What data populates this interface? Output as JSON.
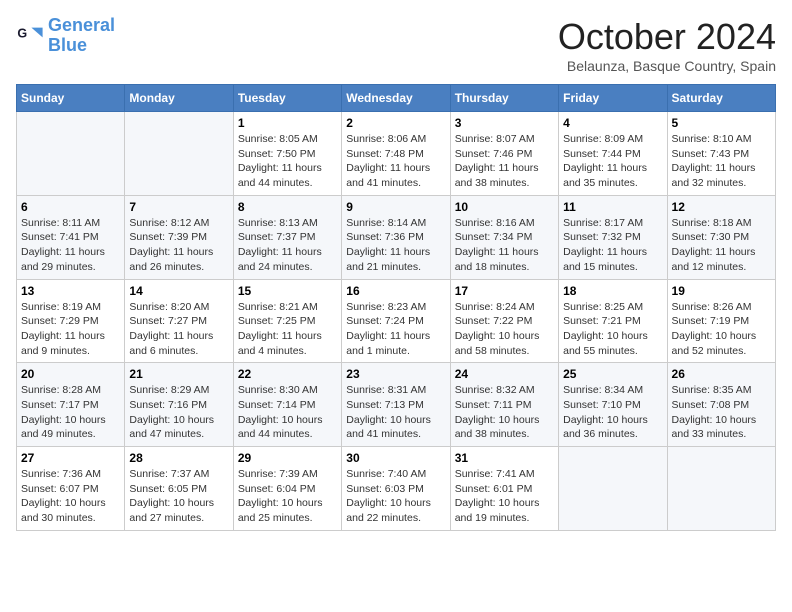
{
  "header": {
    "logo_line1": "General",
    "logo_line2": "Blue",
    "month": "October 2024",
    "location": "Belaunza, Basque Country, Spain"
  },
  "weekdays": [
    "Sunday",
    "Monday",
    "Tuesday",
    "Wednesday",
    "Thursday",
    "Friday",
    "Saturday"
  ],
  "weeks": [
    [
      {
        "day": "",
        "info": ""
      },
      {
        "day": "",
        "info": ""
      },
      {
        "day": "1",
        "info": "Sunrise: 8:05 AM\nSunset: 7:50 PM\nDaylight: 11 hours and 44 minutes."
      },
      {
        "day": "2",
        "info": "Sunrise: 8:06 AM\nSunset: 7:48 PM\nDaylight: 11 hours and 41 minutes."
      },
      {
        "day": "3",
        "info": "Sunrise: 8:07 AM\nSunset: 7:46 PM\nDaylight: 11 hours and 38 minutes."
      },
      {
        "day": "4",
        "info": "Sunrise: 8:09 AM\nSunset: 7:44 PM\nDaylight: 11 hours and 35 minutes."
      },
      {
        "day": "5",
        "info": "Sunrise: 8:10 AM\nSunset: 7:43 PM\nDaylight: 11 hours and 32 minutes."
      }
    ],
    [
      {
        "day": "6",
        "info": "Sunrise: 8:11 AM\nSunset: 7:41 PM\nDaylight: 11 hours and 29 minutes."
      },
      {
        "day": "7",
        "info": "Sunrise: 8:12 AM\nSunset: 7:39 PM\nDaylight: 11 hours and 26 minutes."
      },
      {
        "day": "8",
        "info": "Sunrise: 8:13 AM\nSunset: 7:37 PM\nDaylight: 11 hours and 24 minutes."
      },
      {
        "day": "9",
        "info": "Sunrise: 8:14 AM\nSunset: 7:36 PM\nDaylight: 11 hours and 21 minutes."
      },
      {
        "day": "10",
        "info": "Sunrise: 8:16 AM\nSunset: 7:34 PM\nDaylight: 11 hours and 18 minutes."
      },
      {
        "day": "11",
        "info": "Sunrise: 8:17 AM\nSunset: 7:32 PM\nDaylight: 11 hours and 15 minutes."
      },
      {
        "day": "12",
        "info": "Sunrise: 8:18 AM\nSunset: 7:30 PM\nDaylight: 11 hours and 12 minutes."
      }
    ],
    [
      {
        "day": "13",
        "info": "Sunrise: 8:19 AM\nSunset: 7:29 PM\nDaylight: 11 hours and 9 minutes."
      },
      {
        "day": "14",
        "info": "Sunrise: 8:20 AM\nSunset: 7:27 PM\nDaylight: 11 hours and 6 minutes."
      },
      {
        "day": "15",
        "info": "Sunrise: 8:21 AM\nSunset: 7:25 PM\nDaylight: 11 hours and 4 minutes."
      },
      {
        "day": "16",
        "info": "Sunrise: 8:23 AM\nSunset: 7:24 PM\nDaylight: 11 hours and 1 minute."
      },
      {
        "day": "17",
        "info": "Sunrise: 8:24 AM\nSunset: 7:22 PM\nDaylight: 10 hours and 58 minutes."
      },
      {
        "day": "18",
        "info": "Sunrise: 8:25 AM\nSunset: 7:21 PM\nDaylight: 10 hours and 55 minutes."
      },
      {
        "day": "19",
        "info": "Sunrise: 8:26 AM\nSunset: 7:19 PM\nDaylight: 10 hours and 52 minutes."
      }
    ],
    [
      {
        "day": "20",
        "info": "Sunrise: 8:28 AM\nSunset: 7:17 PM\nDaylight: 10 hours and 49 minutes."
      },
      {
        "day": "21",
        "info": "Sunrise: 8:29 AM\nSunset: 7:16 PM\nDaylight: 10 hours and 47 minutes."
      },
      {
        "day": "22",
        "info": "Sunrise: 8:30 AM\nSunset: 7:14 PM\nDaylight: 10 hours and 44 minutes."
      },
      {
        "day": "23",
        "info": "Sunrise: 8:31 AM\nSunset: 7:13 PM\nDaylight: 10 hours and 41 minutes."
      },
      {
        "day": "24",
        "info": "Sunrise: 8:32 AM\nSunset: 7:11 PM\nDaylight: 10 hours and 38 minutes."
      },
      {
        "day": "25",
        "info": "Sunrise: 8:34 AM\nSunset: 7:10 PM\nDaylight: 10 hours and 36 minutes."
      },
      {
        "day": "26",
        "info": "Sunrise: 8:35 AM\nSunset: 7:08 PM\nDaylight: 10 hours and 33 minutes."
      }
    ],
    [
      {
        "day": "27",
        "info": "Sunrise: 7:36 AM\nSunset: 6:07 PM\nDaylight: 10 hours and 30 minutes."
      },
      {
        "day": "28",
        "info": "Sunrise: 7:37 AM\nSunset: 6:05 PM\nDaylight: 10 hours and 27 minutes."
      },
      {
        "day": "29",
        "info": "Sunrise: 7:39 AM\nSunset: 6:04 PM\nDaylight: 10 hours and 25 minutes."
      },
      {
        "day": "30",
        "info": "Sunrise: 7:40 AM\nSunset: 6:03 PM\nDaylight: 10 hours and 22 minutes."
      },
      {
        "day": "31",
        "info": "Sunrise: 7:41 AM\nSunset: 6:01 PM\nDaylight: 10 hours and 19 minutes."
      },
      {
        "day": "",
        "info": ""
      },
      {
        "day": "",
        "info": ""
      }
    ]
  ]
}
